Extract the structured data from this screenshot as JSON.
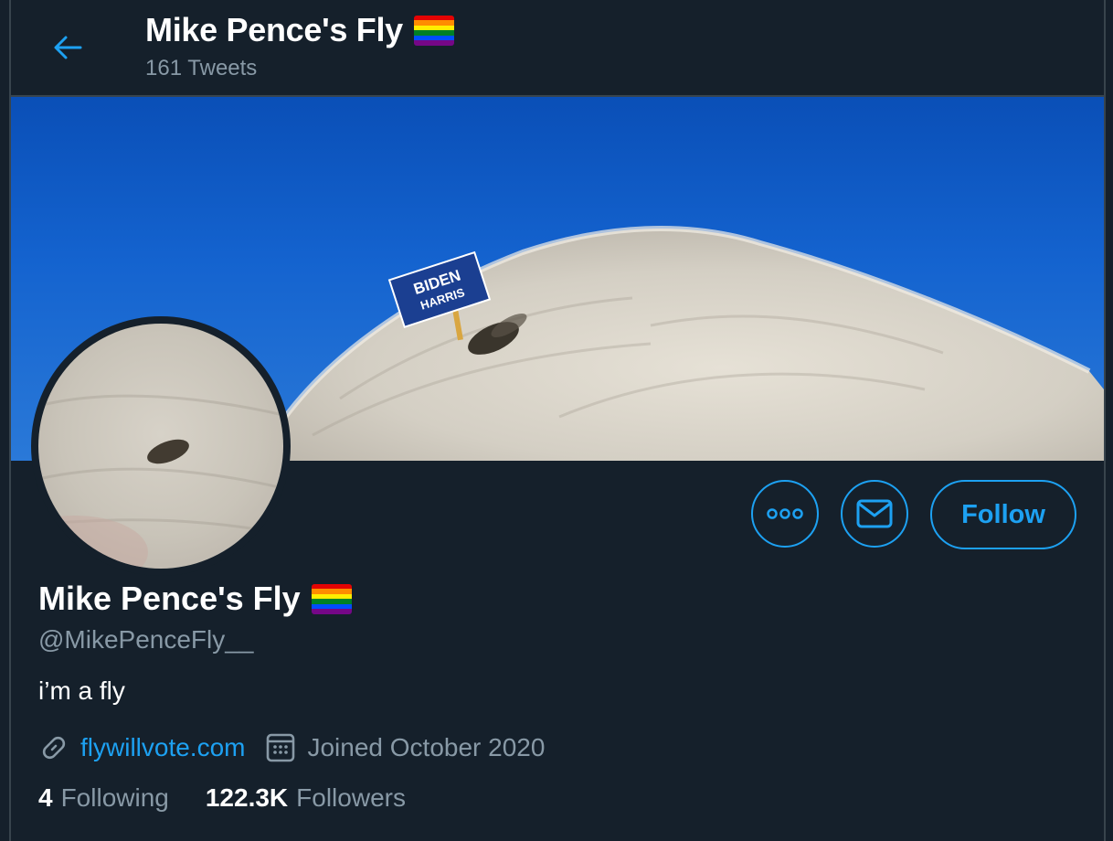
{
  "header": {
    "title": "Mike Pence's Fly",
    "subtitle": "161 Tweets"
  },
  "banner": {
    "sign_line1": "BIDEN",
    "sign_line2": "HARRIS"
  },
  "actions": {
    "more_icon": "more-horizontal-icon",
    "message_icon": "envelope-icon",
    "follow_label": "Follow"
  },
  "profile": {
    "name": "Mike Pence's Fly",
    "handle": "@MikePenceFly__",
    "bio": "i’m a fly",
    "website": "flywillvote.com",
    "joined": "Joined October 2020"
  },
  "stats": {
    "following_count": "4",
    "following_label": "Following",
    "followers_count": "122.3K",
    "followers_label": "Followers"
  },
  "colors": {
    "background": "#15202b",
    "accent": "#1da1f2",
    "muted": "#8899a6",
    "border": "#38444d",
    "flag": [
      "#e40303",
      "#ff8c00",
      "#ffed00",
      "#008026",
      "#004dff",
      "#750787"
    ]
  }
}
